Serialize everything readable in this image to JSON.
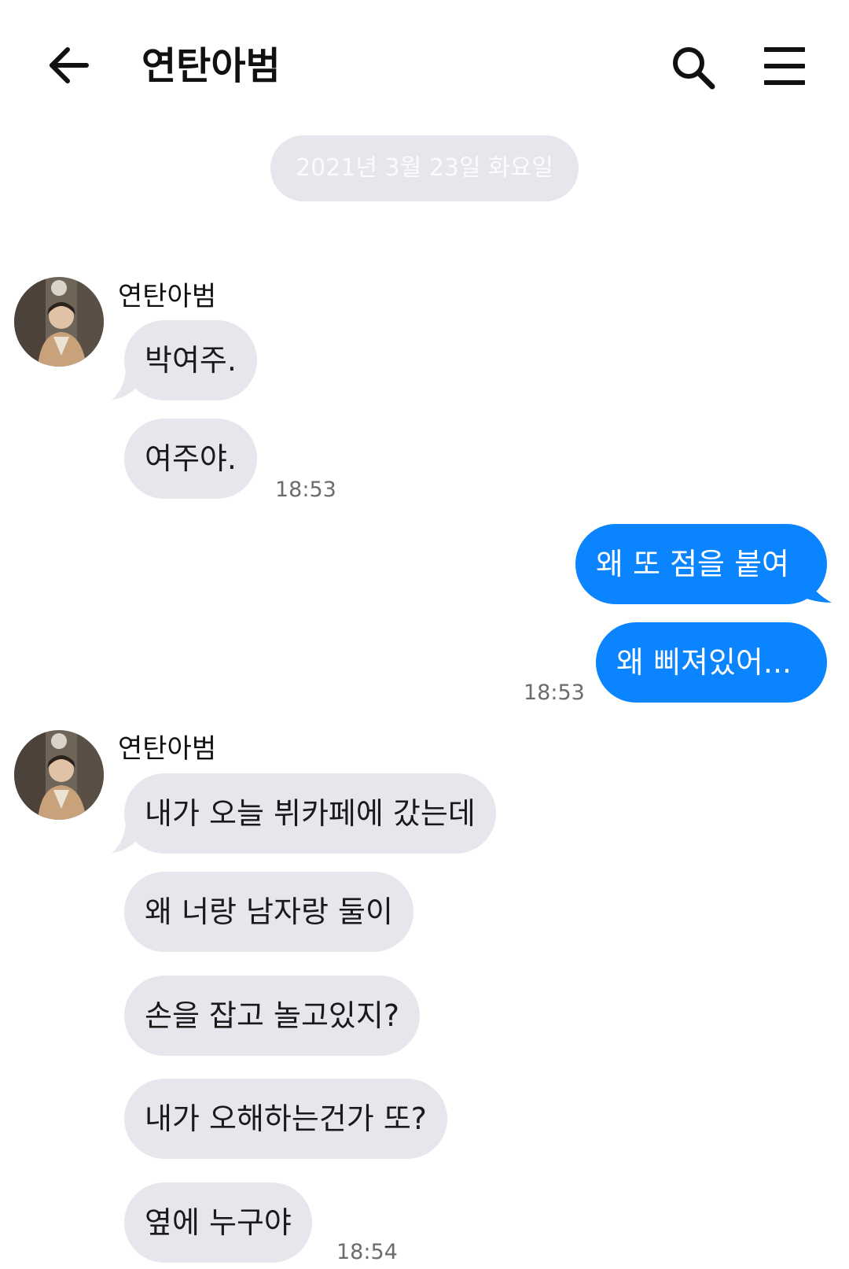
{
  "header": {
    "title": "연탄아범",
    "back_icon": "arrow-left-icon",
    "search_icon": "search-icon",
    "menu_icon": "hamburger-menu-icon"
  },
  "date_divider": "2021년 3월 23일 화요일",
  "colors": {
    "incoming_bubble": "#e6e6ec",
    "outgoing_bubble": "#0a84ff",
    "date_pill": "#e6e6ec",
    "timestamp": "#6b6b70"
  },
  "conversation": {
    "group1": {
      "sender": "연탄아범",
      "messages": [
        "박여주.",
        "여주야."
      ],
      "time": "18:53"
    },
    "group2": {
      "messages": [
        "왜 또 점을 붙여",
        "왜 삐져있어..."
      ],
      "time": "18:53"
    },
    "group3": {
      "sender": "연탄아범",
      "messages": [
        "내가 오늘 뷔카페에 갔는데",
        "왜 너랑 남자랑 둘이",
        "손을 잡고 놀고있지?",
        "내가 오해하는건가 또?",
        "옆에 누구야"
      ],
      "time": "18:54"
    }
  }
}
